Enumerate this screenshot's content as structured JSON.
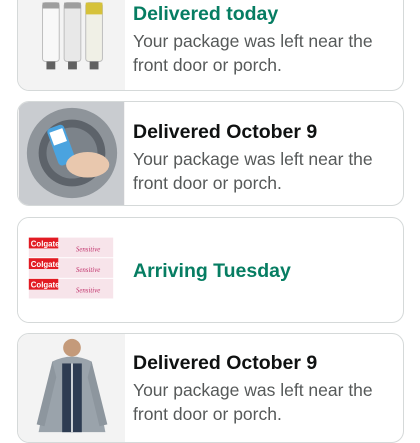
{
  "orders": [
    {
      "status": "Delivered today",
      "status_color": "#067d62",
      "detail": "Your package was left near the front door or porch.",
      "image": "water-filter-cartridges"
    },
    {
      "status": "Delivered October 9",
      "status_color": "#0f1111",
      "detail": "Your package was left near the front door or porch.",
      "image": "washing-machine-cleaner"
    },
    {
      "status": "Arriving Tuesday",
      "status_color": "#067d62",
      "detail": "",
      "image": "colgate-sensitive-toothpaste",
      "image_text": {
        "brand": "Colgate",
        "product": "Sensitive"
      }
    },
    {
      "status": "Delivered October 9",
      "status_color": "#0f1111",
      "detail": "Your package was left near the front door or porch.",
      "image": "gray-zip-hoodie"
    }
  ]
}
